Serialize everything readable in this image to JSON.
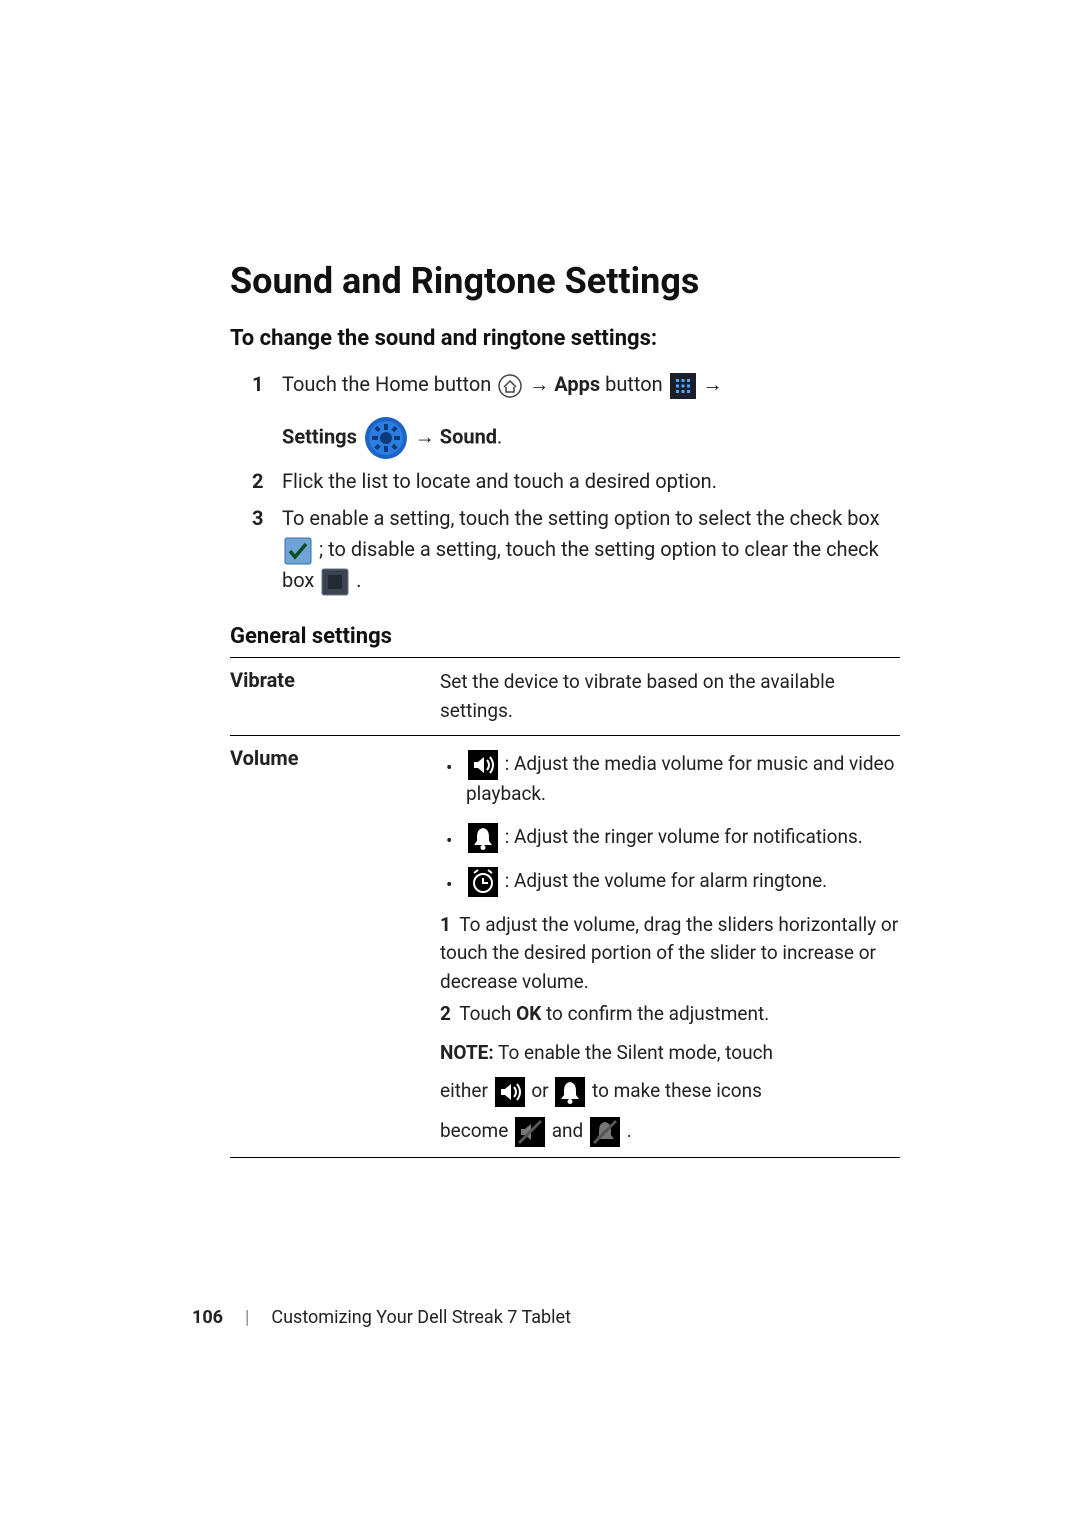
{
  "heading": "Sound and Ringtone Settings",
  "intro": "To change the sound and ringtone settings:",
  "steps": [
    {
      "num": "1",
      "t1": "Touch the Home button ",
      "t2": " → ",
      "apps": "Apps",
      "t3": " button ",
      "t4": " →",
      "settings": "Settings",
      "t5": " → ",
      "sound": "Sound",
      "t6": "."
    },
    {
      "num": "2",
      "t1": "Flick the list to locate and touch a desired option."
    },
    {
      "num": "3",
      "t1": "To enable a setting, touch the setting option to select the check box ",
      "t2": " ; to disable a setting, touch the setting option to clear the check box ",
      "t3": " ."
    }
  ],
  "general": {
    "title": "General settings",
    "rows": {
      "vibrate": {
        "label": "Vibrate",
        "desc": "Set the device to vibrate based on the available settings."
      },
      "volume": {
        "label": "Volume",
        "bul1": ": Adjust the media volume for music and video playback.",
        "bul2": ": Adjust the ringer volume for notifications.",
        "bul3": ": Adjust the volume for alarm ringtone.",
        "sn1_num": "1",
        "sn1_txt_a": " To adjust the volume, drag the sliders horizontally or touch the desired portion of the slider to increase or decrease volume.",
        "sn2_num": "2",
        "sn2_txt_a": " Touch ",
        "sn2_ok": "OK",
        "sn2_txt_b": " to confirm the adjustment.",
        "note_label": "NOTE:",
        "note_txt": " To enable the Silent mode, touch",
        "icons_a": "either ",
        "icons_b": " or ",
        "icons_c": " to make these icons",
        "icons_d": "become ",
        "icons_e": " and ",
        "icons_f": " ."
      }
    }
  },
  "footer": {
    "page": "106",
    "divider": "|",
    "label": "Customizing Your Dell Streak 7 Tablet"
  }
}
